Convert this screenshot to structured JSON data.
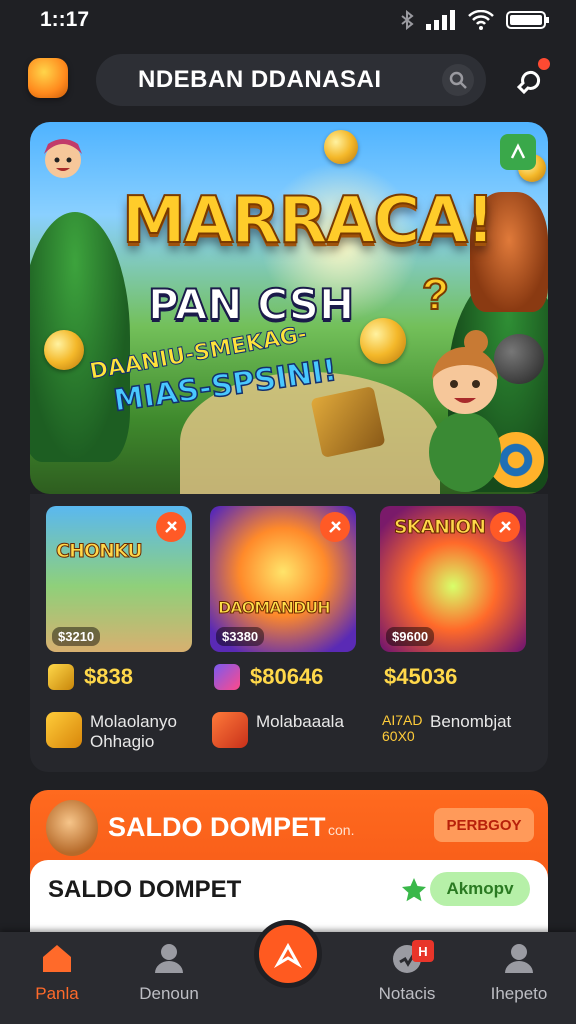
{
  "status_bar": {
    "time": "1::17"
  },
  "header": {
    "search_text": "NDEBAN DDANASAI"
  },
  "hero": {
    "title": "MARRACA!",
    "subtitle": "PAN CSH",
    "question_mark": "?",
    "line1": "DAANIU-SMEKAG-",
    "line2": "MIAS-SPSINI!"
  },
  "games": [
    {
      "card_title": "CHONKU",
      "card_price": "$3210",
      "price": "$838",
      "info": "Molaolanyo Ohhagio"
    },
    {
      "card_title": "DAOMANDUH",
      "card_price": "$3380",
      "price": "$80646",
      "info": "Molabaaala"
    },
    {
      "card_title": "SKANION",
      "card_price": "$9600",
      "price": "$45036",
      "info_prefix": "AI7AD 60X0",
      "info": "Benombjat"
    }
  ],
  "wallet": {
    "header_title": "SALDO DOMPET",
    "header_small": "con.",
    "header_button": "PERBGOY",
    "card_title": "SALDO DOMPET",
    "card_button": "Akmopv"
  },
  "nav": {
    "items": [
      {
        "label": "Panla",
        "active": true
      },
      {
        "label": "Denoun",
        "active": false
      },
      {
        "label": "Notacis",
        "active": false,
        "badge": "H"
      },
      {
        "label": "Ihepeto",
        "active": false
      }
    ]
  },
  "colors": {
    "accent": "#ff5a20",
    "background": "#1f2024",
    "gold": "#ffd84a"
  }
}
